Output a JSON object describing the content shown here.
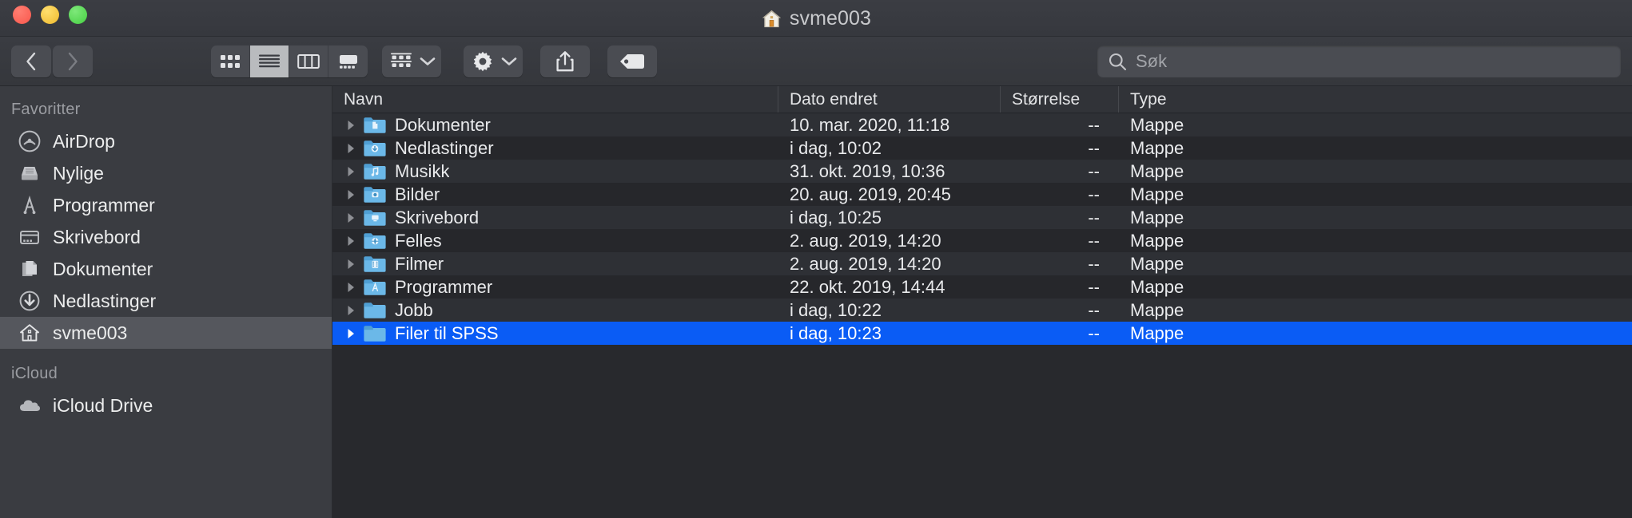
{
  "window": {
    "title": "svme003",
    "title_icon": "home-folder-icon",
    "traffic_lights": [
      {
        "name": "close",
        "color": "#f9574c"
      },
      {
        "name": "minimize",
        "color": "#efb92d"
      },
      {
        "name": "zoom",
        "color": "#46cf42"
      }
    ]
  },
  "toolbar": {
    "back_label": "‹",
    "forward_label": "›",
    "view_modes": [
      {
        "name": "icon-view",
        "active": false
      },
      {
        "name": "list-view",
        "active": true
      },
      {
        "name": "column-view",
        "active": false
      },
      {
        "name": "gallery-view",
        "active": false
      }
    ],
    "group_button": "group-items-button",
    "action_button": "action-gear-button",
    "share_button": "share-button",
    "tag_button": "tag-button"
  },
  "search": {
    "placeholder": "Søk",
    "value": ""
  },
  "sidebar": {
    "sections": [
      {
        "header": "Favoritter",
        "items": [
          {
            "label": "AirDrop",
            "icon": "airdrop-icon",
            "selected": false
          },
          {
            "label": "Nylige",
            "icon": "recents-icon",
            "selected": false
          },
          {
            "label": "Programmer",
            "icon": "applications-icon",
            "selected": false
          },
          {
            "label": "Skrivebord",
            "icon": "desktop-icon",
            "selected": false
          },
          {
            "label": "Dokumenter",
            "icon": "documents-icon",
            "selected": false
          },
          {
            "label": "Nedlastinger",
            "icon": "downloads-icon",
            "selected": false
          },
          {
            "label": "svme003",
            "icon": "home-icon",
            "selected": true
          }
        ]
      },
      {
        "header": "iCloud",
        "items": [
          {
            "label": "iCloud Drive",
            "icon": "icloud-icon",
            "selected": false
          }
        ]
      }
    ]
  },
  "file_list": {
    "columns": [
      {
        "key": "name",
        "label": "Navn"
      },
      {
        "key": "date",
        "label": "Dato endret"
      },
      {
        "key": "size",
        "label": "Størrelse"
      },
      {
        "key": "type",
        "label": "Type"
      }
    ],
    "rows": [
      {
        "name": "Dokumenter",
        "date": "10. mar. 2020, 11:18",
        "size": "--",
        "type": "Mappe",
        "icon": "folder-documents-icon",
        "selected": false
      },
      {
        "name": "Nedlastinger",
        "date": "i dag, 10:02",
        "size": "--",
        "type": "Mappe",
        "icon": "folder-downloads-icon",
        "selected": false
      },
      {
        "name": "Musikk",
        "date": "31. okt. 2019, 10:36",
        "size": "--",
        "type": "Mappe",
        "icon": "folder-music-icon",
        "selected": false
      },
      {
        "name": "Bilder",
        "date": "20. aug. 2019, 20:45",
        "size": "--",
        "type": "Mappe",
        "icon": "folder-pictures-icon",
        "selected": false
      },
      {
        "name": "Skrivebord",
        "date": "i dag, 10:25",
        "size": "--",
        "type": "Mappe",
        "icon": "folder-desktop-icon",
        "selected": false
      },
      {
        "name": "Felles",
        "date": "2. aug. 2019, 14:20",
        "size": "--",
        "type": "Mappe",
        "icon": "folder-public-icon",
        "selected": false
      },
      {
        "name": "Filmer",
        "date": "2. aug. 2019, 14:20",
        "size": "--",
        "type": "Mappe",
        "icon": "folder-movies-icon",
        "selected": false
      },
      {
        "name": "Programmer",
        "date": "22. okt. 2019, 14:44",
        "size": "--",
        "type": "Mappe",
        "icon": "folder-applications-icon",
        "selected": false
      },
      {
        "name": "Jobb",
        "date": "i dag, 10:22",
        "size": "--",
        "type": "Mappe",
        "icon": "folder-plain-icon",
        "selected": false
      },
      {
        "name": "Filer til SPSS",
        "date": "i dag, 10:23",
        "size": "--",
        "type": "Mappe",
        "icon": "folder-plain-icon",
        "selected": true
      }
    ]
  },
  "colors": {
    "selection_blue": "#0a5cf5",
    "folder_blue": "#6bb8e8",
    "window_bg": "#32343a",
    "sidebar_bg": "#3a3c41",
    "list_bg": "#28292d"
  }
}
